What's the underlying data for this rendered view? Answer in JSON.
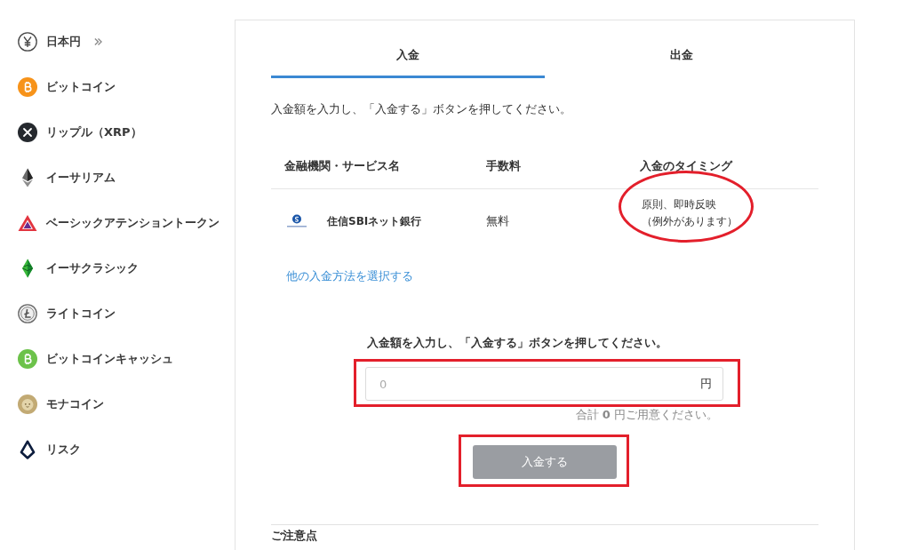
{
  "sidebar": {
    "items": [
      {
        "label": "日本円",
        "kind": "yen",
        "selected": true
      },
      {
        "label": "ビットコイン",
        "kind": "bitcoin",
        "selected": false
      },
      {
        "label": "リップル（XRP）",
        "kind": "xrp",
        "selected": false
      },
      {
        "label": "イーサリアム",
        "kind": "ethereum",
        "selected": false
      },
      {
        "label": "ベーシックアテンショントークン",
        "kind": "bat",
        "selected": false
      },
      {
        "label": "イーサクラシック",
        "kind": "etc",
        "selected": false
      },
      {
        "label": "ライトコイン",
        "kind": "litecoin",
        "selected": false
      },
      {
        "label": "ビットコインキャッシュ",
        "kind": "bch",
        "selected": false
      },
      {
        "label": "モナコイン",
        "kind": "mona",
        "selected": false
      },
      {
        "label": "リスク",
        "kind": "lisk",
        "selected": false
      }
    ]
  },
  "tabs": [
    {
      "label": "入金",
      "selected": true
    },
    {
      "label": "出金",
      "selected": false
    }
  ],
  "instruction": "入金額を入力し、「入金する」ボタンを押してください。",
  "table": {
    "columns": [
      "金融機関・サービス名",
      "手数料",
      "入金のタイミング"
    ],
    "rows": [
      {
        "name": "住信SBIネット銀行",
        "fee": "無料",
        "timing": [
          "原則、即時反映",
          "（例外があります）"
        ],
        "highlighted": true
      }
    ]
  },
  "other_methods_link": "他の入金方法を選択する",
  "deposit_form": {
    "label": "入金額を入力し、「入金する」ボタンを押してください。",
    "amount_field": {
      "placeholder": "0",
      "unit": "円",
      "highlighted": true
    },
    "total_note": "合計 **0** 円ご用意ください。",
    "submit_button": {
      "label": "入金する",
      "disabled": true,
      "highlighted": true
    }
  },
  "notes_heading": "ご注意点"
}
